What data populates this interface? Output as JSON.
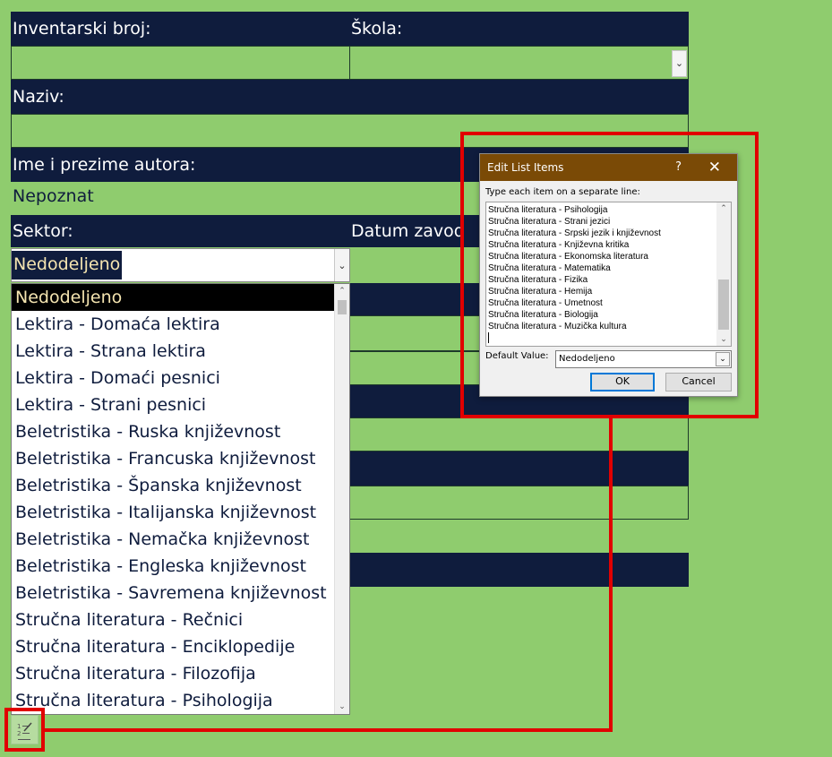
{
  "form": {
    "inventar_label": "Inventarski broj:",
    "skola_label": "Škola:",
    "naziv_label": "Naziv:",
    "autor_label": "Ime i prezime autora:",
    "autor_value": "Nepoznat",
    "sektor_label": "Sektor:",
    "datum_label": "Datum zavod",
    "sektor_value": "Nedodeljeno"
  },
  "dropdown": {
    "items": [
      "Nedodeljeno",
      "Lektira - Domaća lektira",
      "Lektira - Strana lektira",
      "Lektira - Domaći pesnici",
      "Lektira - Strani pesnici",
      "Beletristika - Ruska književnost",
      "Beletristika - Francuska književnost",
      "Beletristika - Španska književnost",
      "Beletristika - Italijanska književnost",
      "Beletristika - Nemačka književnost",
      "Beletristika - Engleska književnost",
      "Beletristika - Savremena književnost",
      "Stručna literatura - Rečnici",
      "Stručna literatura - Enciklopedije",
      "Stručna literatura - Filozofija",
      "Stručna literatura - Psihologija"
    ]
  },
  "dialog": {
    "title": "Edit List Items",
    "help": "?",
    "close": "✕",
    "instruction": "Type each item on a separate line:",
    "items": [
      "Stručna literatura - Psihologija",
      "Stručna literatura - Strani jezici",
      "Stručna literatura - Srpski jezik i književnost",
      "Stručna literatura - Književna kritika",
      "Stručna literatura - Ekonomska literatura",
      "Stručna literatura - Matematika",
      "Stručna literatura - Fizika",
      "Stručna literatura - Hemija",
      "Stručna literatura - Umetnost",
      "Stručna literatura - Biologija",
      "Stručna literatura - Muzička kultura"
    ],
    "default_label": "Default Value:",
    "default_value": "Nedodeljeno",
    "ok_label": "OK",
    "cancel_label": "Cancel"
  },
  "colors": {
    "background": "#8fcc6e",
    "header": "#0f1c3d",
    "highlight": "#e10000",
    "dialog_title": "#7a4a06"
  },
  "icons": {
    "dropdown_arrow": "chevron-down-icon",
    "edit_list": "edit-list-icon"
  }
}
